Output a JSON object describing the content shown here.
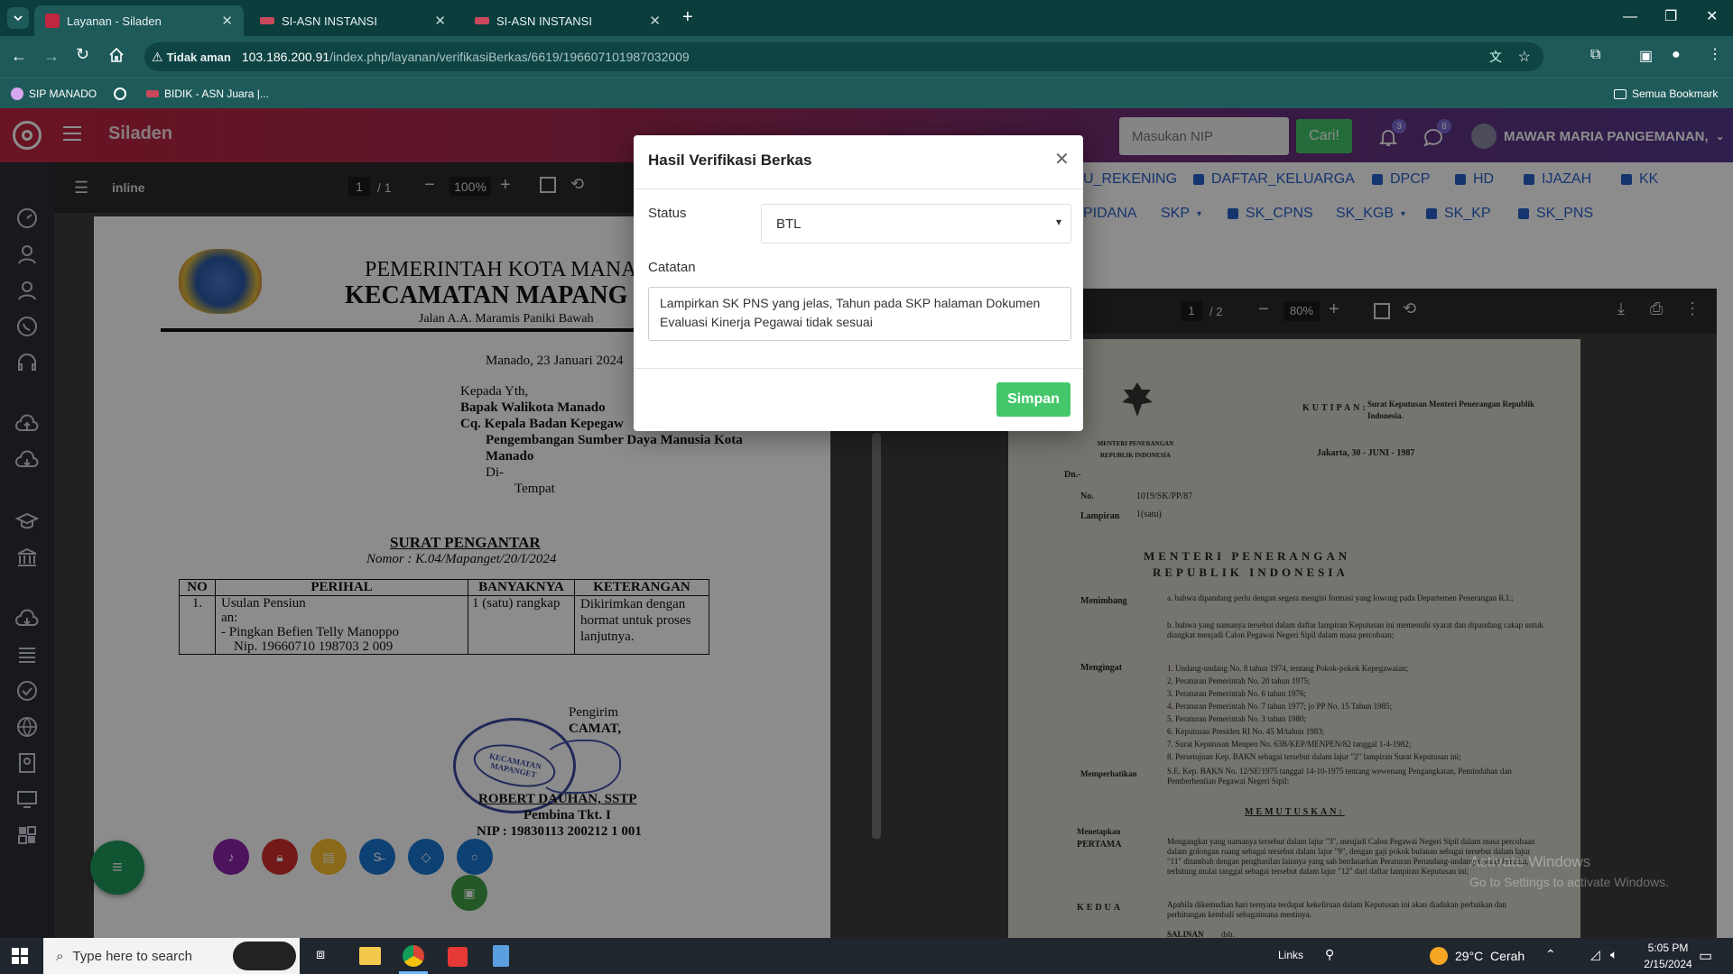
{
  "browser": {
    "tabs": [
      {
        "title": "Layanan - Siladen"
      },
      {
        "title": "SI-ASN INSTANSI"
      },
      {
        "title": "SI-ASN INSTANSI"
      }
    ],
    "security_label": "Tidak aman",
    "url_host": "103.186.200.91",
    "url_path": "/index.php/layanan/verifikasiBerkas/6619/196607101987032009",
    "bookmarks": [
      "SIP MANADO",
      "BIDIK - ASN Juara |..."
    ],
    "all_bookmarks": "Semua Bookmark"
  },
  "app": {
    "brand": "Siladen",
    "nip_placeholder": "Masukan NIP",
    "search_btn": "Cari!",
    "notif_count": "3",
    "msg_count": "8",
    "user_name": "MAWAR MARIA PANGEMANAN,"
  },
  "left_viewer": {
    "title": "inline",
    "page": "1",
    "pages": "/ 1",
    "zoom": "100%"
  },
  "letter": {
    "gov": "PEMERINTAH KOTA MANAD",
    "dept": "KECAMATAN MAPANG",
    "addr": "Jalan A.A. Maramis Paniki Bawah",
    "date": "Manado, 23 Januari 2024",
    "to1": "Kepada Yth,",
    "to2": "Bapak Walikota Manado",
    "to3": "Cq. Kepala Badan Kepegaw",
    "to4": "Pengembangan Sumber Daya Manusia Kota",
    "to5": "Manado",
    "to6": "Di-",
    "to7": "Tempat",
    "subject": "SURAT PENGANTAR",
    "number": "Nomor : K.04/Mapanget/20/I/2024",
    "table_headers": [
      "NO",
      "PERIHAL",
      "BANYAKNYA",
      "KETERANGAN"
    ],
    "row_no": "1.",
    "row_perihal": [
      "Usulan Pensiun",
      "an:",
      "- Pingkan Befien Telly Manoppo",
      "Nip. 19660710 198703 2 009"
    ],
    "row_banyak": "1 (satu) rangkap",
    "row_ket": [
      "Dikirimkan dengan",
      "hormat untuk proses",
      "lanjutnya."
    ],
    "sender": "Pengirim",
    "camat": "CAMAT,",
    "signer": "ROBERT DAUHAN, SSTP",
    "rank": "Pembina Tkt. I",
    "nip": "NIP : 19830113 200212 1 001",
    "stamp": "KECAMATAN MAPANGET"
  },
  "right_tabs": {
    "row1": [
      "U_REKENING",
      "DAFTAR_KELUARGA",
      "DPCP",
      "HD",
      "IJAZAH",
      "KK"
    ],
    "row2": [
      "PIDANA",
      "SKP",
      "SK_CPNS",
      "SK_KGB",
      "SK_KP",
      "SK_PNS"
    ]
  },
  "right_viewer": {
    "page": "1",
    "pages": "/ 2",
    "zoom": "80%"
  },
  "sk": {
    "kutipan": "KUTIPAN:",
    "kutipan_text": "Surat Keputusan Menteri Penerangan Republik Indonesia.",
    "ministry": "MENTERI PENERANGAN REPUBLIK INDONESIA",
    "place_date": "Jakarta, 30 - JUNI - 1987",
    "dn": "Dn.-",
    "no_label": "No.",
    "no_val": "1019/SK/PP/87",
    "lampiran_label": "Lampiran",
    "lampiran_val": "1(satu)",
    "heading1": "MENTERI PENERANGAN",
    "heading2": "REPUBLIK INDONESIA",
    "menimbang": "Menimbang",
    "mengingat": "Mengingat",
    "memperhatikan": "Memperhatikan",
    "memutuskan": "MEMUTUSKAN:",
    "menetapkan": "Menetapkan",
    "pertama": "PERTAMA",
    "kedua": "KEDUA",
    "salinan": "SALINAN",
    "menimbang_a": "a. bahwa dipandang perlu dengan segera mengisi formasi yang lowong pada Departemen Penerangan R.I.;",
    "menimbang_b": "b. bahwa yang namanya tersebut dalam daftar lampiran Keputusan ini memenuhi syarat dan dipandang cakap untuk diangkat menjadi Calon Pegawai Negeri Sipil dalam masa percobaan;",
    "mengingat_items": [
      "1. Undang-undang No. 8 tahun 1974, tentang Pokok-pokok Kepegawaian;",
      "2. Peraturan Pemerintah No. 20 tahun 1975;",
      "3. Peraturan Pemerintah No. 6 tahun 1976;",
      "4. Peraturan Pemerintah No. 7 tahun 1977; jo PP No. 15 Tahun 1985;",
      "5. Peraturan Pemerintah No. 3 tahun 1980;",
      "6. Keputusan Presiden RI No. 45 M/tahun 1983;",
      "7. Surat Keputusan Menpen No. 63B/KEP/MENPEN/82 tanggal 1-4-1982;",
      "8. Persetujuan Kep. BAKN sebagai tersebut dalam lajur \"2\" lampiran Surat Keputusan ini;"
    ],
    "memperhatikan_text": "S.E. Kep. BAKN No. 12/SE/1975 tanggal 14-10-1975 tentang wewenang Pengangkatan, Pemindahan dan Pemberhentian Pegawai Negeri Sipil;",
    "pertama_text": "Mengangkat yang namanya tersebut dalam lajur \"3\", menjadi Calon Pegawai Negeri Sipil dalam masa percobaan dalam golongan ruang sebagai tersebut dalam lajur \"9\", dengan gaji pokok bulanan sebagai tersebut dalam lajur \"11\" ditambah dengan penghasilan lainnya yang sah berdasarkan Peraturan Perundang-undangan yang berlaku, terhitung mulai tanggal sebagai tersebut dalam lajur \"12\" dari daftar lampiran Keputusan ini;",
    "kedua_text": "Apabila dikemudian hari ternyata terdapat kekeliruan dalam Keputusan ini akan diadakan perbaikan dan perhitungan kembali sebagaimana mestinya.",
    "salinan_text": "dsb."
  },
  "watermark": {
    "line1": "Activate Windows",
    "line2": "Go to Settings to activate Windows."
  },
  "modal": {
    "title": "Hasil Verifikasi Berkas",
    "status_label": "Status",
    "status_value": "BTL",
    "catatan_label": "Catatan",
    "catatan_value": "Lampirkan SK PNS yang jelas, Tahun pada SKP halaman Dokumen Evaluasi Kinerja Pegawai tidak sesuai",
    "save_btn": "Simpan"
  },
  "taskbar": {
    "search_placeholder": "Type here to search",
    "links": "Links",
    "weather": "29°C  Cerah",
    "time": "5:05 PM",
    "date": "2/15/2024"
  },
  "fab_colors": [
    "#8e24aa",
    "#d32f2f",
    "#fbc02d",
    "#1976d2",
    "#1976d2",
    "#1976d2",
    "#43a047"
  ]
}
